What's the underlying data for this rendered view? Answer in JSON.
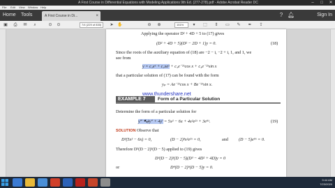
{
  "window": {
    "title": "A First Course in Differential Equations with Modeling Applications 9th Ed. (277-278).pdf - Adobe Acrobat Reader DC",
    "controls": [
      "–",
      "□",
      "✕"
    ]
  },
  "menu": [
    "File",
    "Edit",
    "View",
    "Window",
    "Help"
  ],
  "tabs": {
    "home": "Home",
    "tools": "Tools",
    "document": "A First Course in Di...",
    "sign_in": "Sign In"
  },
  "toolbar": {
    "page_value": "7/4",
    "page_total": "(229 of 830)",
    "zoom": "151%"
  },
  "document": {
    "line1": "Applying the operator D² + 4D + 5 to (17) gives",
    "eq18": "(D² + 4D + 5)(D² − 2D + 1)y = 0.",
    "eq18_num": "(18)",
    "line2": "Since the roots of the auxiliary equation of (18) are −2 − i, −2 + i, 1, and 1, we",
    "line3": "see from",
    "eq_y": "y = c₁eˣ + c₂xeˣ + c₃e⁻²ˣcos x + c₄e⁻²ˣsin x",
    "line4": "that a particular solution of (17) can be found with the form",
    "eq_yp": "yₚ = Ae⁻²ˣcos x + Be⁻²ˣsin x.",
    "watermark": "www.thundershare.net",
    "example_label": "EXAMPLE 7",
    "example_title": "Form of a Particular Solution",
    "line5": "Determine the form of a particular solution for",
    "eq19_left": "y‴ − 4y″ + 4y′",
    "eq19_right": " = 5x² − 6x + 4x²e²ˣ + 3e⁵ˣ.",
    "eq19_num": "(19)",
    "solution_label": "SOLUTION",
    "solution_text": "Observe that",
    "ann1": "D³(5x² − 6x) = 0,",
    "ann2": "(D − 2)³x²e²ˣ = 0,",
    "ann_and": "and",
    "ann3": "(D − 5)e⁵ˣ = 0.",
    "line6": "Therefore D³(D − 2)³(D − 5) applied to (19) gives",
    "eq_a": "D³(D − 2)³(D − 5)(D³ − 4D² + 4D)y = 0",
    "or_label": "or",
    "eq_b": "D⁴(D − 2)⁵(D − 5)y = 0."
  },
  "taskbar": {
    "time": "9:44 AM",
    "date": "7/23/2020"
  },
  "colors": {
    "titlebar": "#2b2b2b",
    "tabbar": "#3a3a3a",
    "taskbar": "#1e2a3a",
    "example_bg": "#5a5a5a",
    "highlight": "#b5c8f2",
    "watermark": "#1f2fbf",
    "solution": "#c23a1a"
  }
}
